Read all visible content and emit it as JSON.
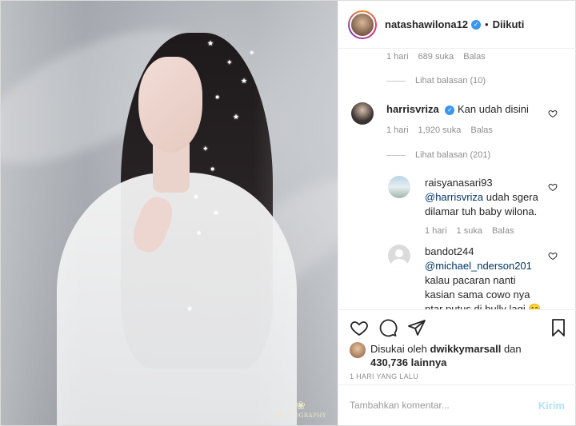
{
  "post": {
    "username": "natashawilona12",
    "follow_status": "Diikuti",
    "dot": "•",
    "watermark": "PHOTOGRAPHY"
  },
  "comments": {
    "first_meta": {
      "time": "1 hari",
      "likes": "689 suka",
      "reply": "Balas"
    },
    "first_view_replies": "Lihat balasan (10)",
    "harris": {
      "username": "harrisvriza",
      "text": "Kan udah disini",
      "time": "1 hari",
      "likes": "1,920 suka",
      "reply": "Balas",
      "view_replies": "Lihat balasan (201)"
    },
    "raisya": {
      "username": "raisyanasari93",
      "mention": "@harrisvriza",
      "text": " udah sgera dilamar tuh baby wilona.",
      "time": "1 hari",
      "likes": "1 suka",
      "reply": "Balas"
    },
    "bandot": {
      "username": "bandot244",
      "mention": "@michael_nderson201",
      "text": "kalau pacaran nanti kasian sama cowo nya ntar putus di bully lagi 😄"
    }
  },
  "likes": {
    "prefix": "Disukai oleh ",
    "user": "dwikkymarsall",
    "suffix": " dan",
    "count": "430,736 lainnya"
  },
  "timestamp": "1 HARI YANG LALU",
  "add_comment": {
    "placeholder": "Tambahkan komentar...",
    "post_label": "Kirim"
  },
  "icons": {
    "heart": "heart-icon",
    "comment": "comment-icon",
    "share": "share-icon",
    "save": "bookmark-icon",
    "verified": "verified-badge-icon"
  },
  "colors": {
    "verified": "#3897f0",
    "meta_gray": "#8e8e8e",
    "post_button": "#b2dffc"
  }
}
